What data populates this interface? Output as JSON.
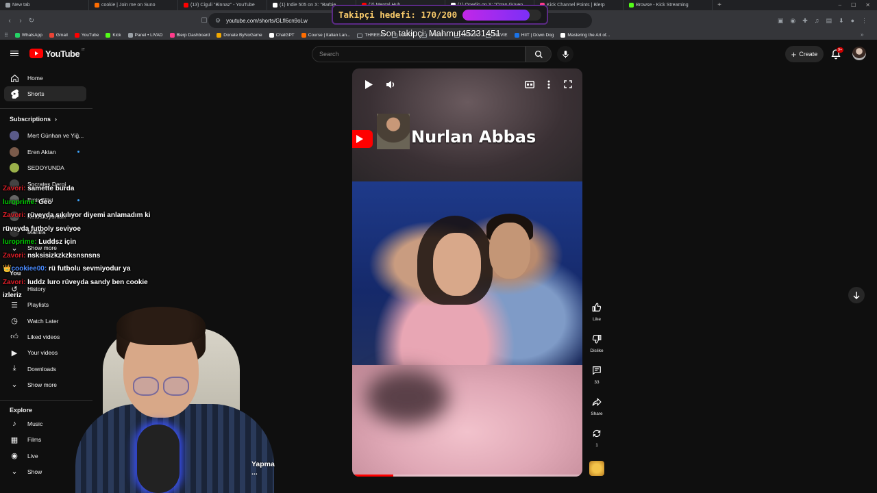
{
  "browser": {
    "tabs": [
      {
        "label": "New tab",
        "color": "#9aa0a6"
      },
      {
        "label": "cookie | Join me on Suno",
        "color": "#ff6d00"
      },
      {
        "label": "(13) Ciguli \"Binnaz\" - YouTube",
        "color": "#ff0000"
      },
      {
        "label": "(1) Indie 505 on X: \"Barbie...",
        "color": "#ffffff"
      },
      {
        "label": "(2) Mental Hub...",
        "color": "#ff0000"
      },
      {
        "label": "(1) Onedio on X: \"Ozan Güven...",
        "color": "#ffffff"
      },
      {
        "label": "Kick Channel Points | Blerp",
        "color": "#ff3b8b"
      },
      {
        "label": "Browse - Kick Streaming",
        "color": "#53fc18"
      }
    ],
    "new_tab": "+",
    "url": "youtube.com/shorts/GLfl6cn9oLw",
    "bookmarks": [
      {
        "label": "WhatsApp",
        "color": "#25d366",
        "kind": "site"
      },
      {
        "label": "Gmail",
        "color": "#ea4335",
        "kind": "site"
      },
      {
        "label": "YouTube",
        "color": "#ff0000",
        "kind": "site"
      },
      {
        "label": "Kick",
        "color": "#53fc18",
        "kind": "site"
      },
      {
        "label": "Panel • LIVAD",
        "color": "#9aa0a6",
        "kind": "site"
      },
      {
        "label": "Blerp Dashboard",
        "color": "#ff3b8b",
        "kind": "site"
      },
      {
        "label": "Donate ByNoGame",
        "color": "#f2a900",
        "kind": "site"
      },
      {
        "label": "ChatGPT",
        "color": "#ffffff",
        "kind": "site"
      },
      {
        "label": "Course | Italian Lan...",
        "color": "#ff6d00",
        "kind": "site"
      },
      {
        "label": "THREEJS",
        "color": "",
        "kind": "folder"
      },
      {
        "label": "REACT",
        "color": "",
        "kind": "folder"
      },
      {
        "label": "SPORTS",
        "color": "",
        "kind": "folder"
      },
      {
        "label": "DESIGN",
        "color": "",
        "kind": "folder"
      },
      {
        "label": "MOVIE",
        "color": "",
        "kind": "folder"
      },
      {
        "label": "HIIT | Down Dog",
        "color": "#1a73e8",
        "kind": "site"
      },
      {
        "label": "Mastering the Art of...",
        "color": "#ffffff",
        "kind": "site"
      }
    ]
  },
  "overlay": {
    "follower_goal_text": "Takipçi hedefi: 170/200",
    "follower_current": 170,
    "follower_target": 200,
    "last_follower": "Son takipçi: Mahmut45231451"
  },
  "youtube": {
    "logo_text": "YouTube",
    "logo_country": "IT",
    "search_placeholder": "Search",
    "create_label": "Create",
    "notification_count": "9+"
  },
  "sidebar": {
    "main": [
      {
        "label": "Home",
        "icon": "home-icon"
      },
      {
        "label": "Shorts",
        "icon": "shorts-icon"
      }
    ],
    "subscriptions_title": "Subscriptions",
    "subscriptions": [
      {
        "label": "Mert Günhan ve Yiğ...",
        "color": "#5a5a8a",
        "dot": false
      },
      {
        "label": "Eren Aktan",
        "color": "#7a5a4a",
        "dot": true
      },
      {
        "label": "SEDOYUNDA",
        "color": "#9ab04a",
        "dot": false
      },
      {
        "label": "Socrates Dergi",
        "color": "#444",
        "dot": false
      },
      {
        "label": "Emir Bilici",
        "color": "#666",
        "dot": true
      },
      {
        "label": "Ketos Oyunları",
        "color": "#555",
        "dot": false
      },
      {
        "label": "Mantra",
        "color": "#333",
        "dot": false
      }
    ],
    "show_more_subs": "Show more",
    "you_title": "You",
    "you": [
      {
        "label": "History",
        "icon": "history-icon"
      },
      {
        "label": "Playlists",
        "icon": "playlists-icon"
      },
      {
        "label": "Watch Later",
        "icon": "watch-later-icon"
      },
      {
        "label": "Liked videos",
        "icon": "liked-videos-icon"
      },
      {
        "label": "Your videos",
        "icon": "your-videos-icon"
      },
      {
        "label": "Downloads",
        "icon": "downloads-icon"
      },
      {
        "label": "Show more",
        "icon": "chevron-down-icon"
      }
    ],
    "explore_title": "Explore",
    "explore": [
      {
        "label": "Music",
        "icon": "music-icon"
      },
      {
        "label": "Films",
        "icon": "films-icon"
      },
      {
        "label": "Live",
        "icon": "live-icon"
      },
      {
        "label": "Show",
        "icon": "chevron-down-icon"
      }
    ]
  },
  "chat": [
    {
      "user": "Zavori:",
      "msg": "samette burda",
      "cls": "u-z"
    },
    {
      "user": "luroprime:",
      "msg": "Geo",
      "cls": "u-l"
    },
    {
      "user": "Zavori:",
      "msg": "rüveyda sıkılıyor diyemi anlamadım ki rüveyda futboly seviyoe",
      "cls": "u-z"
    },
    {
      "user": "luroprime:",
      "msg": "Luddsz için",
      "cls": "u-l"
    },
    {
      "user": "Zavori:",
      "msg": "nsksisizkzkzksnsnsns",
      "cls": "u-z"
    },
    {
      "user": "cookiee00:",
      "msg": "rü futbolu sevmiyodur ya",
      "cls": "u-c",
      "crown": "👑"
    },
    {
      "user": "Zavori:",
      "msg": "luddz luro rüveyda sandy ben cookie izleriz",
      "cls": "u-z"
    }
  ],
  "webcam_caption": "Yapma ...",
  "short": {
    "video_title_text": "Nurlan Abbas",
    "progress": 0.18,
    "actions": {
      "like": "Like",
      "dislike": "Dislike",
      "comments": "33",
      "share": "Share",
      "remix": "1"
    }
  }
}
